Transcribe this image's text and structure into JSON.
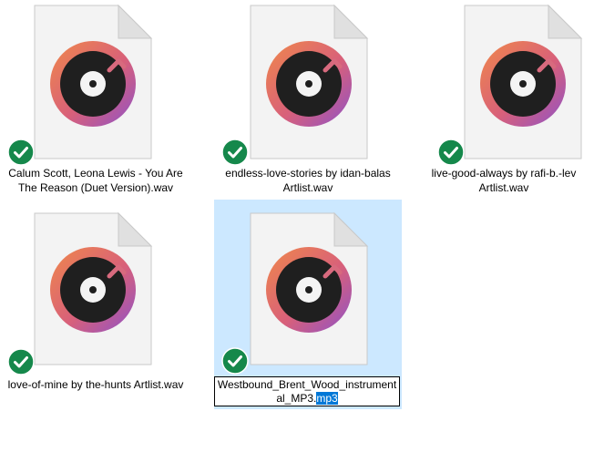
{
  "colors": {
    "selection_background": "#cce8ff",
    "text_selection": "#0078d7",
    "sync_badge": "#15884b"
  },
  "icons": {
    "file_type": "media-player-disc-icon",
    "badge": "synced-checkmark-icon"
  },
  "files": [
    {
      "name": "Calum Scott, Leona Lewis - You Are The Reason (Duet Version).wav",
      "selected": false
    },
    {
      "name": "endless-love-stories by idan-balas Artlist.wav",
      "selected": false
    },
    {
      "name": "live-good-always by rafi-b.-lev Artlist.wav",
      "selected": false
    },
    {
      "name": "love-of-mine by the-hunts Artlist.wav",
      "selected": false
    },
    {
      "name": "Westbound_Brent_Wood_instrumental_MP3.mp3",
      "selected": true,
      "rename_base": "Westbound_Brent_Wood_instrumental_MP3.",
      "rename_selected": "mp3"
    }
  ]
}
